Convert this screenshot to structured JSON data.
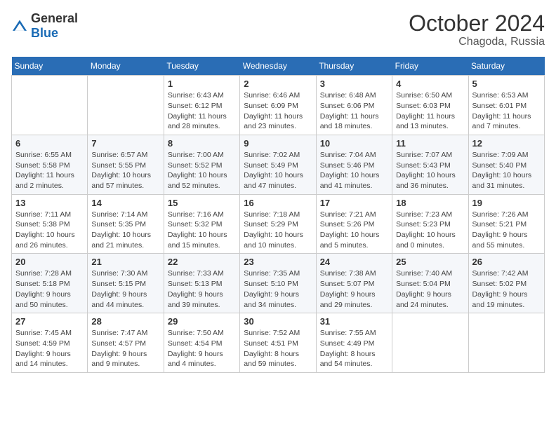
{
  "header": {
    "logo": {
      "general": "General",
      "blue": "Blue"
    },
    "title": "October 2024",
    "subtitle": "Chagoda, Russia"
  },
  "weekdays": [
    "Sunday",
    "Monday",
    "Tuesday",
    "Wednesday",
    "Thursday",
    "Friday",
    "Saturday"
  ],
  "weeks": [
    [
      null,
      null,
      {
        "day": 1,
        "sunrise": "Sunrise: 6:43 AM",
        "sunset": "Sunset: 6:12 PM",
        "daylight": "Daylight: 11 hours and 28 minutes."
      },
      {
        "day": 2,
        "sunrise": "Sunrise: 6:46 AM",
        "sunset": "Sunset: 6:09 PM",
        "daylight": "Daylight: 11 hours and 23 minutes."
      },
      {
        "day": 3,
        "sunrise": "Sunrise: 6:48 AM",
        "sunset": "Sunset: 6:06 PM",
        "daylight": "Daylight: 11 hours and 18 minutes."
      },
      {
        "day": 4,
        "sunrise": "Sunrise: 6:50 AM",
        "sunset": "Sunset: 6:03 PM",
        "daylight": "Daylight: 11 hours and 13 minutes."
      },
      {
        "day": 5,
        "sunrise": "Sunrise: 6:53 AM",
        "sunset": "Sunset: 6:01 PM",
        "daylight": "Daylight: 11 hours and 7 minutes."
      }
    ],
    [
      {
        "day": 6,
        "sunrise": "Sunrise: 6:55 AM",
        "sunset": "Sunset: 5:58 PM",
        "daylight": "Daylight: 11 hours and 2 minutes."
      },
      {
        "day": 7,
        "sunrise": "Sunrise: 6:57 AM",
        "sunset": "Sunset: 5:55 PM",
        "daylight": "Daylight: 10 hours and 57 minutes."
      },
      {
        "day": 8,
        "sunrise": "Sunrise: 7:00 AM",
        "sunset": "Sunset: 5:52 PM",
        "daylight": "Daylight: 10 hours and 52 minutes."
      },
      {
        "day": 9,
        "sunrise": "Sunrise: 7:02 AM",
        "sunset": "Sunset: 5:49 PM",
        "daylight": "Daylight: 10 hours and 47 minutes."
      },
      {
        "day": 10,
        "sunrise": "Sunrise: 7:04 AM",
        "sunset": "Sunset: 5:46 PM",
        "daylight": "Daylight: 10 hours and 41 minutes."
      },
      {
        "day": 11,
        "sunrise": "Sunrise: 7:07 AM",
        "sunset": "Sunset: 5:43 PM",
        "daylight": "Daylight: 10 hours and 36 minutes."
      },
      {
        "day": 12,
        "sunrise": "Sunrise: 7:09 AM",
        "sunset": "Sunset: 5:40 PM",
        "daylight": "Daylight: 10 hours and 31 minutes."
      }
    ],
    [
      {
        "day": 13,
        "sunrise": "Sunrise: 7:11 AM",
        "sunset": "Sunset: 5:38 PM",
        "daylight": "Daylight: 10 hours and 26 minutes."
      },
      {
        "day": 14,
        "sunrise": "Sunrise: 7:14 AM",
        "sunset": "Sunset: 5:35 PM",
        "daylight": "Daylight: 10 hours and 21 minutes."
      },
      {
        "day": 15,
        "sunrise": "Sunrise: 7:16 AM",
        "sunset": "Sunset: 5:32 PM",
        "daylight": "Daylight: 10 hours and 15 minutes."
      },
      {
        "day": 16,
        "sunrise": "Sunrise: 7:18 AM",
        "sunset": "Sunset: 5:29 PM",
        "daylight": "Daylight: 10 hours and 10 minutes."
      },
      {
        "day": 17,
        "sunrise": "Sunrise: 7:21 AM",
        "sunset": "Sunset: 5:26 PM",
        "daylight": "Daylight: 10 hours and 5 minutes."
      },
      {
        "day": 18,
        "sunrise": "Sunrise: 7:23 AM",
        "sunset": "Sunset: 5:23 PM",
        "daylight": "Daylight: 10 hours and 0 minutes."
      },
      {
        "day": 19,
        "sunrise": "Sunrise: 7:26 AM",
        "sunset": "Sunset: 5:21 PM",
        "daylight": "Daylight: 9 hours and 55 minutes."
      }
    ],
    [
      {
        "day": 20,
        "sunrise": "Sunrise: 7:28 AM",
        "sunset": "Sunset: 5:18 PM",
        "daylight": "Daylight: 9 hours and 50 minutes."
      },
      {
        "day": 21,
        "sunrise": "Sunrise: 7:30 AM",
        "sunset": "Sunset: 5:15 PM",
        "daylight": "Daylight: 9 hours and 44 minutes."
      },
      {
        "day": 22,
        "sunrise": "Sunrise: 7:33 AM",
        "sunset": "Sunset: 5:13 PM",
        "daylight": "Daylight: 9 hours and 39 minutes."
      },
      {
        "day": 23,
        "sunrise": "Sunrise: 7:35 AM",
        "sunset": "Sunset: 5:10 PM",
        "daylight": "Daylight: 9 hours and 34 minutes."
      },
      {
        "day": 24,
        "sunrise": "Sunrise: 7:38 AM",
        "sunset": "Sunset: 5:07 PM",
        "daylight": "Daylight: 9 hours and 29 minutes."
      },
      {
        "day": 25,
        "sunrise": "Sunrise: 7:40 AM",
        "sunset": "Sunset: 5:04 PM",
        "daylight": "Daylight: 9 hours and 24 minutes."
      },
      {
        "day": 26,
        "sunrise": "Sunrise: 7:42 AM",
        "sunset": "Sunset: 5:02 PM",
        "daylight": "Daylight: 9 hours and 19 minutes."
      }
    ],
    [
      {
        "day": 27,
        "sunrise": "Sunrise: 7:45 AM",
        "sunset": "Sunset: 4:59 PM",
        "daylight": "Daylight: 9 hours and 14 minutes."
      },
      {
        "day": 28,
        "sunrise": "Sunrise: 7:47 AM",
        "sunset": "Sunset: 4:57 PM",
        "daylight": "Daylight: 9 hours and 9 minutes."
      },
      {
        "day": 29,
        "sunrise": "Sunrise: 7:50 AM",
        "sunset": "Sunset: 4:54 PM",
        "daylight": "Daylight: 9 hours and 4 minutes."
      },
      {
        "day": 30,
        "sunrise": "Sunrise: 7:52 AM",
        "sunset": "Sunset: 4:51 PM",
        "daylight": "Daylight: 8 hours and 59 minutes."
      },
      {
        "day": 31,
        "sunrise": "Sunrise: 7:55 AM",
        "sunset": "Sunset: 4:49 PM",
        "daylight": "Daylight: 8 hours and 54 minutes."
      },
      null,
      null
    ]
  ]
}
